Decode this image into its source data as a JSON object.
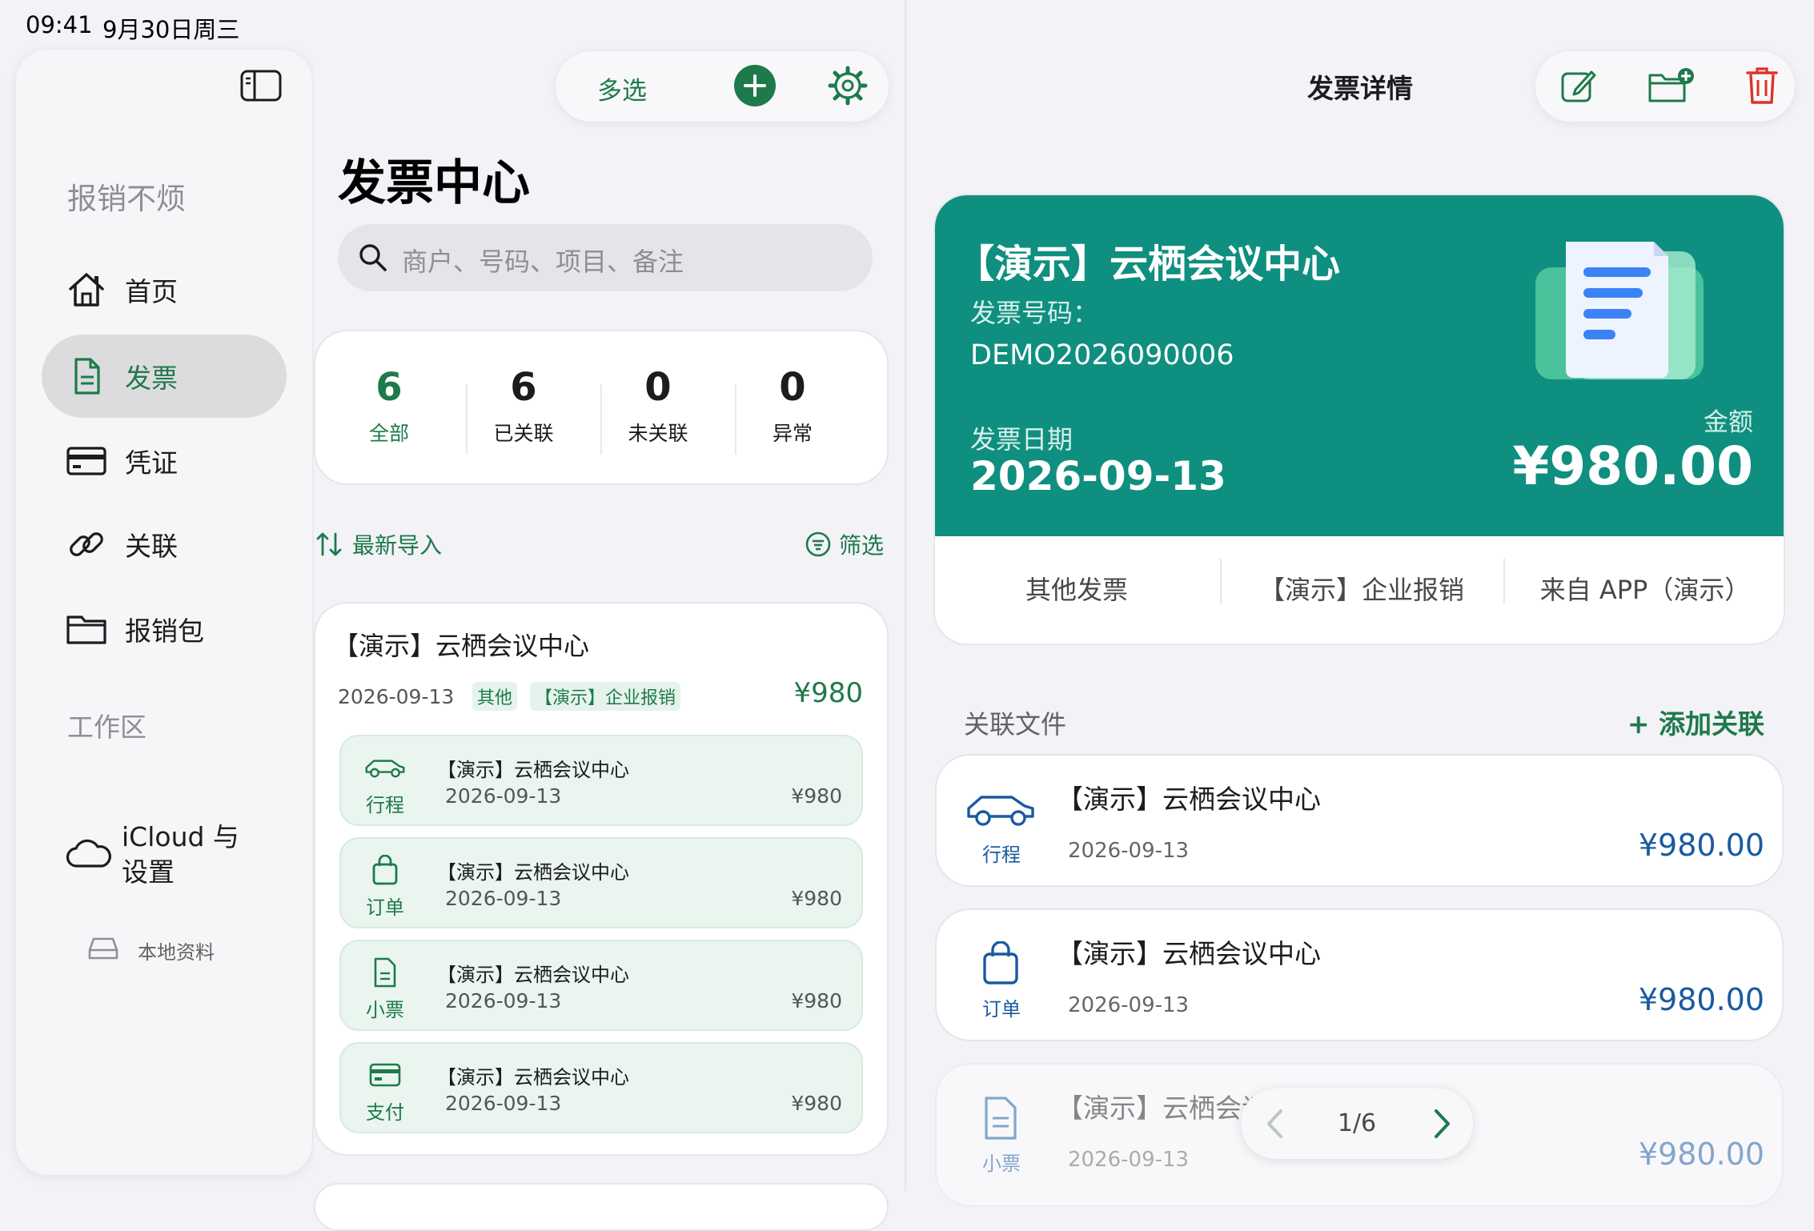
{
  "status_bar": {
    "time": "09:41",
    "date": "9月30日周三"
  },
  "sidebar": {
    "app_title": "报销不烦",
    "items": [
      {
        "label": "首页",
        "icon": "house-icon"
      },
      {
        "label": "发票",
        "icon": "document-icon"
      },
      {
        "label": "凭证",
        "icon": "card-icon"
      },
      {
        "label": "关联",
        "icon": "link-icon"
      },
      {
        "label": "报销包",
        "icon": "folder-icon"
      }
    ],
    "workspace_heading": "工作区",
    "icloud_label": "iCloud 与\n设置",
    "local_label": "本地资料"
  },
  "toolbar": {
    "multi_select": "多选"
  },
  "list": {
    "title": "发票中心",
    "search_placeholder": "商户、号码、项目、备注",
    "stats": [
      {
        "value": "6",
        "label": "全部"
      },
      {
        "value": "6",
        "label": "已关联"
      },
      {
        "value": "0",
        "label": "未关联"
      },
      {
        "value": "0",
        "label": "异常"
      }
    ],
    "sort_label": "最新导入",
    "filter_label": "筛选",
    "invoice": {
      "title": "【演示】云栖会议中心",
      "date": "2026-09-13",
      "tag1": "其他",
      "tag2": "【演示】企业报销",
      "amount": "¥980"
    },
    "sub_items": [
      {
        "kind": "行程",
        "title": "【演示】云栖会议中心",
        "date": "2026-09-13",
        "amount": "¥980"
      },
      {
        "kind": "订单",
        "title": "【演示】云栖会议中心",
        "date": "2026-09-13",
        "amount": "¥980"
      },
      {
        "kind": "小票",
        "title": "【演示】云栖会议中心",
        "date": "2026-09-13",
        "amount": "¥980"
      },
      {
        "kind": "支付",
        "title": "【演示】云栖会议中心",
        "date": "2026-09-13",
        "amount": "¥980"
      }
    ]
  },
  "detail": {
    "nav_title": "发票详情",
    "hero": {
      "title": "【演示】云栖会议中心",
      "number_label": "发票号码：",
      "number": "DEMO2026090006",
      "date_label": "发票日期",
      "date": "2026-09-13",
      "amount_label": "金额",
      "amount": "¥980.00",
      "color": "#0f8f7f"
    },
    "meta": [
      "其他发票",
      "【演示】企业报销",
      "来自 APP（演示）"
    ],
    "related_heading": "关联文件",
    "add_link": "+ 添加关联",
    "related": [
      {
        "kind": "行程",
        "title": "【演示】云栖会议中心",
        "date": "2026-09-13",
        "amount": "¥980.00"
      },
      {
        "kind": "订单",
        "title": "【演示】云栖会议中心",
        "date": "2026-09-13",
        "amount": "¥980.00"
      },
      {
        "kind": "小票",
        "title": "【演示】云栖会议中心",
        "date": "2026-09-13",
        "amount": "¥980.00"
      }
    ],
    "pager": "1/6"
  },
  "colors": {
    "accent_green": "#1e7a4a",
    "blue_amount": "#1a5aa0",
    "danger": "#e0302a"
  }
}
